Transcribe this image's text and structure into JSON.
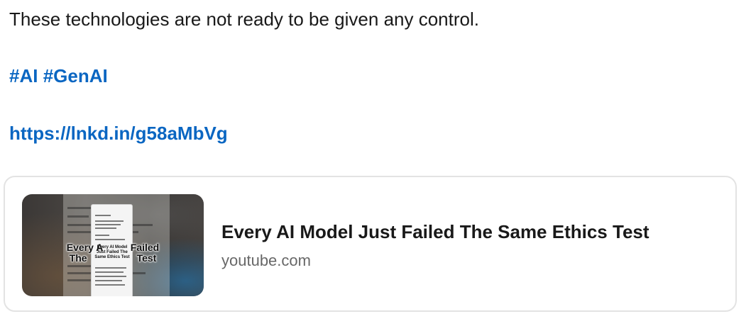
{
  "post": {
    "text": "These technologies are not ready to be given any control.",
    "hashtags": [
      "#AI",
      "#GenAI"
    ],
    "link": "https://lnkd.in/g58aMbVg"
  },
  "link_card": {
    "title": "Every AI Model Just Failed The Same Ethics Test",
    "source": "youtube.com",
    "thumbnail": {
      "caption_line1": "Every A          Failed",
      "caption_line2": "The                  Test",
      "inner_caption": "Every AI Model Just Failed The Same Ethics Test"
    }
  },
  "colors": {
    "link": "#0a66c2",
    "text": "#000000e6",
    "muted": "#00000099",
    "card_border": "#e3e3e3"
  }
}
